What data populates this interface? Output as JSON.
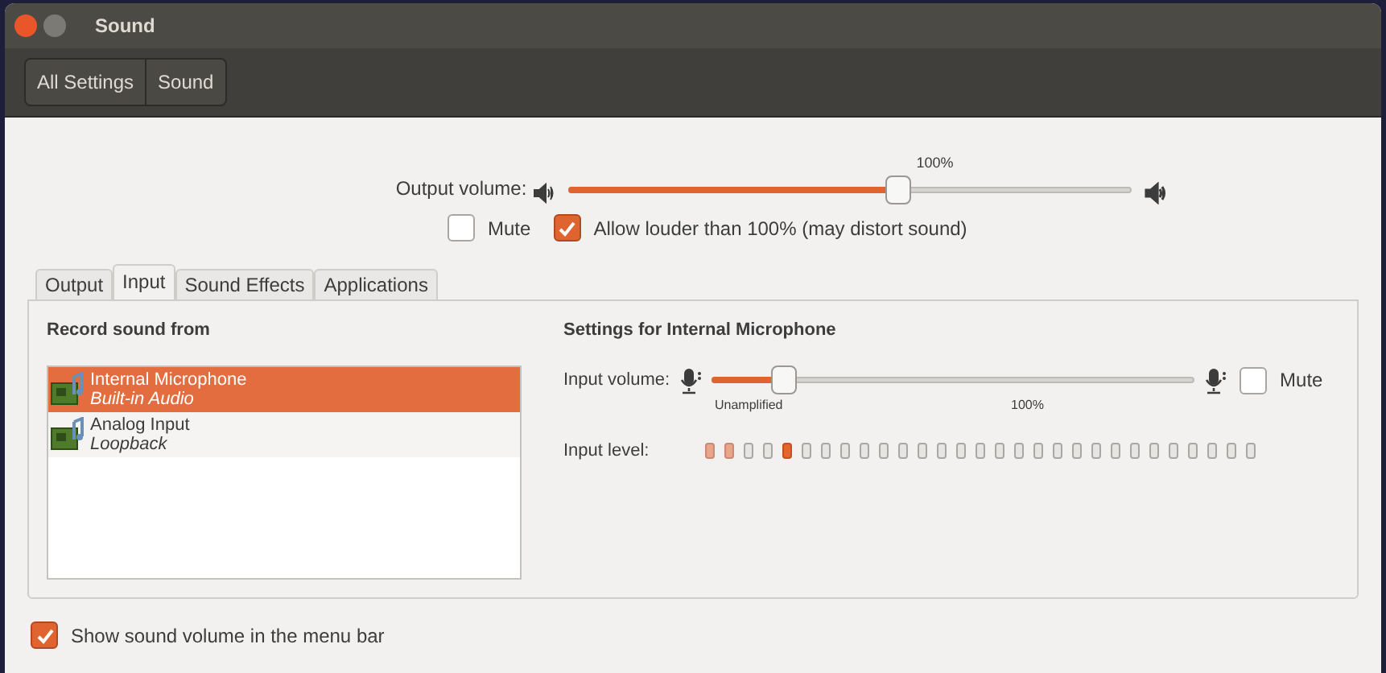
{
  "window": {
    "title": "Sound"
  },
  "breadcrumbs": [
    {
      "label": "All Settings",
      "selected": false
    },
    {
      "label": "Sound",
      "selected": false
    }
  ],
  "output_volume": {
    "label": "Output volume:",
    "level": 0.586,
    "mark_label": "100%"
  },
  "output_mute": {
    "label": "Mute",
    "checked": false
  },
  "allow_louder": {
    "label": "Allow louder than 100% (may distort sound)",
    "checked": true
  },
  "tabs": [
    {
      "label": "Output",
      "selected": false
    },
    {
      "label": "Input",
      "selected": true
    },
    {
      "label": "Sound Effects",
      "selected": false
    },
    {
      "label": "Applications",
      "selected": false
    }
  ],
  "record_from": {
    "heading": "Record sound from",
    "devices": [
      {
        "name": "Internal Microphone",
        "description": "Built-in Audio",
        "selected": true
      },
      {
        "name": "Analog Input",
        "description": "Loopback",
        "selected": false
      }
    ]
  },
  "settings": {
    "heading": "Settings for Internal Microphone",
    "input_volume": {
      "label": "Input volume:",
      "level": 0.15,
      "marks": [
        "Unamplified",
        "100%"
      ]
    },
    "mute": {
      "label": "Mute",
      "checked": false
    },
    "input_level": {
      "label": "Input level:",
      "segments": [
        {
          "kind": "dim"
        },
        {
          "kind": "dim"
        },
        {
          "kind": "off"
        },
        {
          "kind": "off"
        },
        {
          "kind": "peak"
        },
        {
          "kind": "off"
        },
        {
          "kind": "off"
        },
        {
          "kind": "off"
        },
        {
          "kind": "off"
        },
        {
          "kind": "off"
        },
        {
          "kind": "off"
        },
        {
          "kind": "off"
        },
        {
          "kind": "off"
        },
        {
          "kind": "off"
        },
        {
          "kind": "off"
        },
        {
          "kind": "off"
        },
        {
          "kind": "off"
        },
        {
          "kind": "off"
        },
        {
          "kind": "off"
        },
        {
          "kind": "off"
        },
        {
          "kind": "off"
        },
        {
          "kind": "off"
        },
        {
          "kind": "off"
        },
        {
          "kind": "off"
        },
        {
          "kind": "off"
        },
        {
          "kind": "off"
        },
        {
          "kind": "off"
        },
        {
          "kind": "off"
        },
        {
          "kind": "off"
        }
      ]
    }
  },
  "show_in_menu_bar": {
    "label": "Show sound volume in the menu bar",
    "checked": true
  }
}
